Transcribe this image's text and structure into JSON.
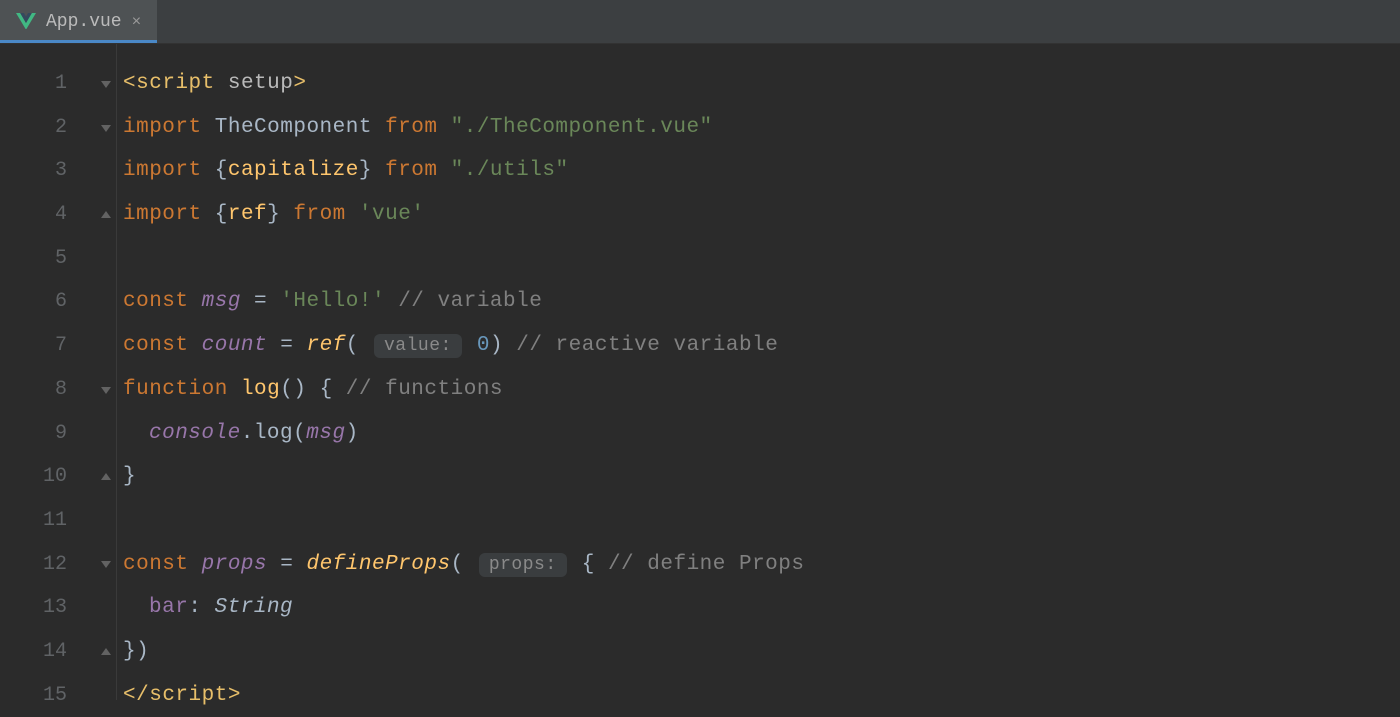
{
  "tab": {
    "filename": "App.vue",
    "close_glyph": "×"
  },
  "gutter": {
    "lines": [
      "1",
      "2",
      "3",
      "4",
      "5",
      "6",
      "7",
      "8",
      "9",
      "10",
      "11",
      "12",
      "13",
      "14",
      "15"
    ]
  },
  "folds": [
    "down",
    "down",
    "",
    "up",
    "",
    "",
    "",
    "down",
    "",
    "up",
    "",
    "down",
    "",
    "up",
    ""
  ],
  "code": {
    "l1": {
      "lt": "<",
      "tag": "script",
      "attr": "setup",
      "gt": ">"
    },
    "l2": {
      "kw": "import",
      "id": "TheComponent",
      "from": "from",
      "str": "\"./TheComponent.vue\""
    },
    "l3": {
      "kw": "import",
      "lb": "{",
      "id": "capitalize",
      "rb": "}",
      "from": "from",
      "str": "\"./utils\""
    },
    "l4": {
      "kw": "import",
      "lb": "{",
      "id": "ref",
      "rb": "}",
      "from": "from",
      "str": "'vue'"
    },
    "l6": {
      "kw": "const",
      "var": "msg",
      "eq": "=",
      "str": "'Hello!'",
      "com": "// variable"
    },
    "l7": {
      "kw": "const",
      "var": "count",
      "eq": "=",
      "fn": "ref",
      "lp": "(",
      "hint": "value:",
      "num": "0",
      "rp": ")",
      "com": "// reactive variable"
    },
    "l8": {
      "kw": "function",
      "fn": "log",
      "parens": "()",
      "lb": "{",
      "com": "// functions"
    },
    "l9": {
      "obj": "console",
      "dot": ".",
      "method": "log",
      "lp": "(",
      "arg": "msg",
      "rp": ")"
    },
    "l10": {
      "rb": "}"
    },
    "l12": {
      "kw": "const",
      "var": "props",
      "eq": "=",
      "fn": "defineProps",
      "lp": "(",
      "hint": "props:",
      "lb": "{",
      "com": "// define Props"
    },
    "l13": {
      "key": "bar",
      "colon": ":",
      "type": "String"
    },
    "l14": {
      "close": "})"
    },
    "l15": {
      "lt": "</",
      "tag": "script",
      "gt": ">"
    }
  }
}
